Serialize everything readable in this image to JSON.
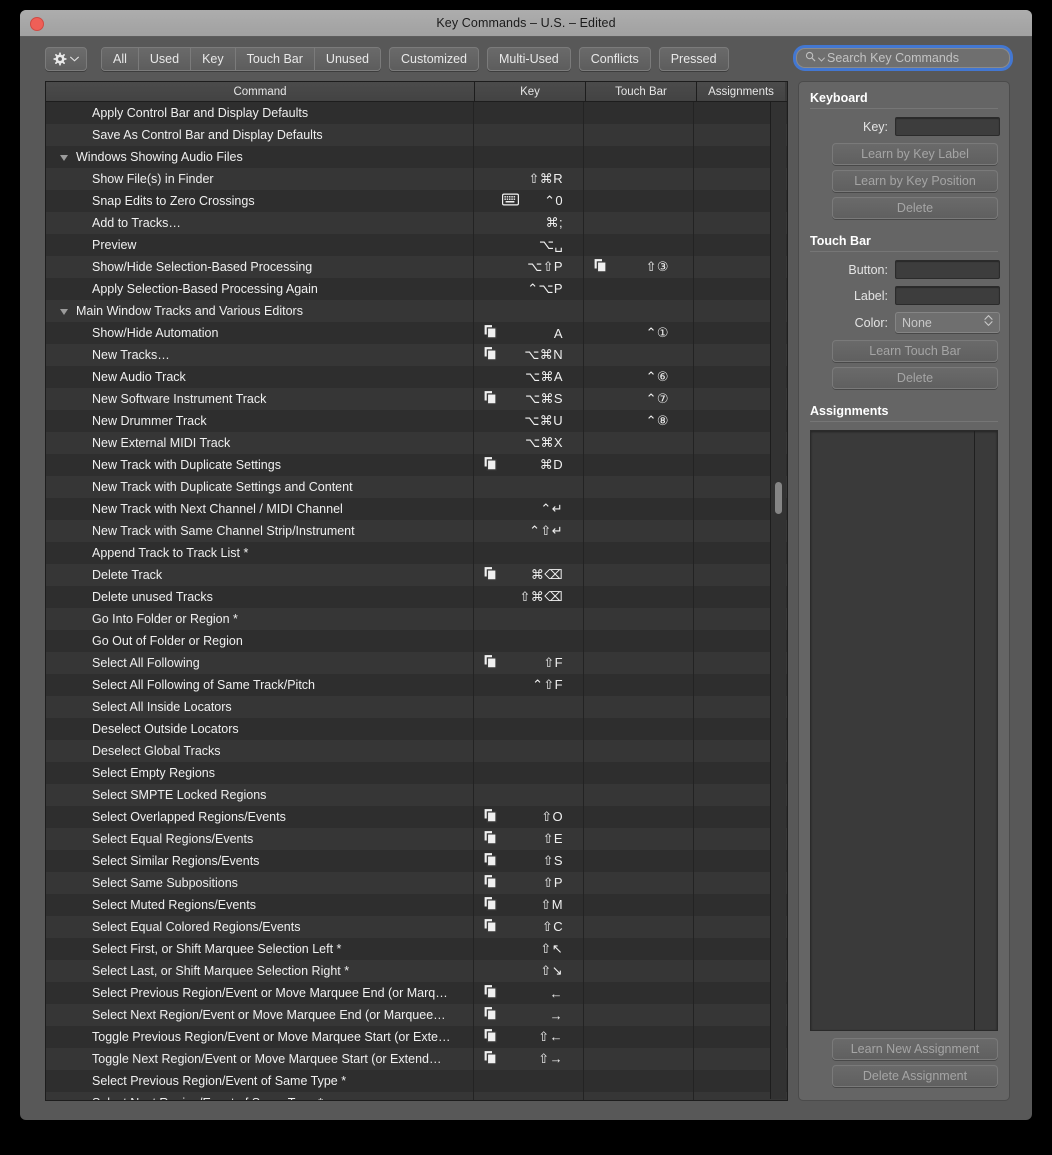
{
  "window": {
    "title": "Key Commands – U.S. – Edited",
    "close_icon": "close-dot"
  },
  "toolbar": {
    "action_menu_icon": "gear-icon",
    "action_menu_chevron": "chevron-down-icon",
    "segments": [
      "All",
      "Used",
      "Key",
      "Touch Bar",
      "Unused"
    ],
    "buttons": [
      "Customized",
      "Multi-Used",
      "Conflicts",
      "Pressed"
    ],
    "search": {
      "icon": "search-icon",
      "chevron": "chevron-down-icon",
      "placeholder": "Search Key Commands",
      "value": "",
      "focus_ring_color": "#407ce6"
    }
  },
  "table": {
    "columns": [
      "Command",
      "Key",
      "Touch Bar",
      "Assignments"
    ],
    "rows": [
      {
        "command": "Apply Control Bar and Display Defaults",
        "indent": 1,
        "key": "",
        "keyicon": "",
        "touchbar": "",
        "assignments": ""
      },
      {
        "command": "Save As Control Bar and Display Defaults",
        "indent": 1,
        "key": "",
        "keyicon": "",
        "touchbar": "",
        "assignments": ""
      },
      {
        "command": "Windows Showing Audio Files",
        "group": true,
        "key": "",
        "keyicon": "",
        "touchbar": "",
        "assignments": ""
      },
      {
        "command": "Show File(s) in Finder",
        "indent": 1,
        "key": "⇧⌘R",
        "keyicon": "",
        "touchbar": "",
        "assignments": ""
      },
      {
        "command": "Snap Edits to Zero Crossings",
        "indent": 1,
        "key": "⌃0",
        "keyicon": "keyboard-icon",
        "touchbar": "",
        "assignments": ""
      },
      {
        "command": "Add to Tracks…",
        "indent": 1,
        "key": "⌘;",
        "keyicon": "",
        "touchbar": "",
        "assignments": ""
      },
      {
        "command": "Preview",
        "indent": 1,
        "key": "⌥␣",
        "keyicon": "",
        "touchbar": "",
        "assignments": ""
      },
      {
        "command": "Show/Hide Selection-Based Processing",
        "indent": 1,
        "key": "⌥⇧P",
        "keyicon": "",
        "tbicon": "duplicate-icon",
        "touchbar": "⇧③",
        "assignments": ""
      },
      {
        "command": "Apply Selection-Based Processing Again",
        "indent": 1,
        "key": "⌃⌥P",
        "keyicon": "",
        "touchbar": "",
        "assignments": ""
      },
      {
        "command": "Main Window Tracks and Various Editors",
        "group": true,
        "key": "",
        "keyicon": "",
        "touchbar": "",
        "assignments": ""
      },
      {
        "command": "Show/Hide Automation",
        "indent": 1,
        "key": "A",
        "keyicon": "duplicate-icon",
        "touchbar": "⌃①",
        "assignments": ""
      },
      {
        "command": "New Tracks…",
        "indent": 1,
        "key": "⌥⌘N",
        "keyicon": "duplicate-icon",
        "touchbar": "",
        "assignments": ""
      },
      {
        "command": "New Audio Track",
        "indent": 1,
        "key": "⌥⌘A",
        "keyicon": "",
        "touchbar": "⌃⑥",
        "assignments": ""
      },
      {
        "command": "New Software Instrument Track",
        "indent": 1,
        "key": "⌥⌘S",
        "keyicon": "duplicate-icon",
        "touchbar": "⌃⑦",
        "assignments": ""
      },
      {
        "command": "New Drummer Track",
        "indent": 1,
        "key": "⌥⌘U",
        "keyicon": "",
        "touchbar": "⌃⑧",
        "assignments": ""
      },
      {
        "command": "New External MIDI Track",
        "indent": 1,
        "key": "⌥⌘X",
        "keyicon": "",
        "touchbar": "",
        "assignments": ""
      },
      {
        "command": "New Track with Duplicate Settings",
        "indent": 1,
        "key": "⌘D",
        "keyicon": "duplicate-icon",
        "touchbar": "",
        "assignments": ""
      },
      {
        "command": "New Track with Duplicate Settings and Content",
        "indent": 1,
        "key": "",
        "keyicon": "",
        "touchbar": "",
        "assignments": ""
      },
      {
        "command": "New Track with Next Channel / MIDI Channel",
        "indent": 1,
        "key": "⌃↵",
        "keyicon": "",
        "touchbar": "",
        "assignments": ""
      },
      {
        "command": "New Track with Same Channel Strip/Instrument",
        "indent": 1,
        "key": "⌃⇧↵",
        "keyicon": "",
        "touchbar": "",
        "assignments": ""
      },
      {
        "command": "Append Track to Track List *",
        "indent": 1,
        "key": "",
        "keyicon": "",
        "touchbar": "",
        "assignments": ""
      },
      {
        "command": "Delete Track",
        "indent": 1,
        "key": "⌘⌫",
        "keyicon": "duplicate-icon",
        "touchbar": "",
        "assignments": ""
      },
      {
        "command": "Delete unused Tracks",
        "indent": 1,
        "key": "⇧⌘⌫",
        "keyicon": "",
        "touchbar": "",
        "assignments": ""
      },
      {
        "command": "Go Into Folder or Region *",
        "indent": 1,
        "key": "",
        "keyicon": "",
        "touchbar": "",
        "assignments": ""
      },
      {
        "command": "Go Out of Folder or Region",
        "indent": 1,
        "key": "",
        "keyicon": "",
        "touchbar": "",
        "assignments": ""
      },
      {
        "command": "Select All Following",
        "indent": 1,
        "key": "⇧F",
        "keyicon": "duplicate-icon",
        "touchbar": "",
        "assignments": ""
      },
      {
        "command": "Select All Following of Same Track/Pitch",
        "indent": 1,
        "key": "⌃⇧F",
        "keyicon": "",
        "touchbar": "",
        "assignments": ""
      },
      {
        "command": "Select All Inside Locators",
        "indent": 1,
        "key": "",
        "keyicon": "",
        "touchbar": "",
        "assignments": ""
      },
      {
        "command": "Deselect Outside Locators",
        "indent": 1,
        "key": "",
        "keyicon": "",
        "touchbar": "",
        "assignments": ""
      },
      {
        "command": "Deselect Global Tracks",
        "indent": 1,
        "key": "",
        "keyicon": "",
        "touchbar": "",
        "assignments": ""
      },
      {
        "command": "Select Empty Regions",
        "indent": 1,
        "key": "",
        "keyicon": "",
        "touchbar": "",
        "assignments": ""
      },
      {
        "command": "Select SMPTE Locked Regions",
        "indent": 1,
        "key": "",
        "keyicon": "",
        "touchbar": "",
        "assignments": ""
      },
      {
        "command": "Select Overlapped Regions/Events",
        "indent": 1,
        "key": "⇧O",
        "keyicon": "duplicate-icon",
        "touchbar": "",
        "assignments": ""
      },
      {
        "command": "Select Equal Regions/Events",
        "indent": 1,
        "key": "⇧E",
        "keyicon": "duplicate-icon",
        "touchbar": "",
        "assignments": ""
      },
      {
        "command": "Select Similar Regions/Events",
        "indent": 1,
        "key": "⇧S",
        "keyicon": "duplicate-icon",
        "touchbar": "",
        "assignments": ""
      },
      {
        "command": "Select Same Subpositions",
        "indent": 1,
        "key": "⇧P",
        "keyicon": "duplicate-icon",
        "touchbar": "",
        "assignments": ""
      },
      {
        "command": "Select Muted Regions/Events",
        "indent": 1,
        "key": "⇧M",
        "keyicon": "duplicate-icon",
        "touchbar": "",
        "assignments": ""
      },
      {
        "command": "Select Equal Colored Regions/Events",
        "indent": 1,
        "key": "⇧C",
        "keyicon": "duplicate-icon",
        "touchbar": "",
        "assignments": ""
      },
      {
        "command": "Select First, or Shift Marquee Selection Left *",
        "indent": 1,
        "key": "⇧↖",
        "keyicon": "",
        "touchbar": "",
        "assignments": ""
      },
      {
        "command": "Select Last, or Shift Marquee Selection Right *",
        "indent": 1,
        "key": "⇧↘",
        "keyicon": "",
        "touchbar": "",
        "assignments": ""
      },
      {
        "command": "Select Previous Region/Event or Move Marquee End (or Marq…",
        "indent": 1,
        "key": "←",
        "keyicon": "duplicate-icon",
        "touchbar": "",
        "assignments": ""
      },
      {
        "command": "Select Next Region/Event or Move Marquee End (or Marquee…",
        "indent": 1,
        "key": "→",
        "keyicon": "duplicate-icon",
        "touchbar": "",
        "assignments": ""
      },
      {
        "command": "Toggle Previous Region/Event or Move Marquee Start (or Exte…",
        "indent": 1,
        "key": "⇧←",
        "keyicon": "duplicate-icon",
        "touchbar": "",
        "assignments": ""
      },
      {
        "command": "Toggle Next Region/Event or Move Marquee Start (or Extend…",
        "indent": 1,
        "key": "⇧→",
        "keyicon": "duplicate-icon",
        "touchbar": "",
        "assignments": ""
      },
      {
        "command": "Select Previous Region/Event of Same Type *",
        "indent": 1,
        "key": "",
        "keyicon": "",
        "touchbar": "",
        "assignments": ""
      },
      {
        "command": "Select Next Region/Event of Same Type *",
        "indent": 1,
        "key": "",
        "keyicon": "",
        "touchbar": "",
        "assignments": "",
        "clipped": true
      }
    ]
  },
  "sidebar": {
    "keyboard": {
      "title": "Keyboard",
      "key_label": "Key:",
      "key_value": "",
      "learn_by_key_label": "Learn by Key Label",
      "learn_by_key_position": "Learn by Key Position",
      "delete": "Delete"
    },
    "touchbar": {
      "title": "Touch Bar",
      "button_label": "Button:",
      "button_value": "",
      "label_label": "Label:",
      "label_value": "",
      "color_label": "Color:",
      "color_value": "None",
      "color_chevron": "chevron-up-down-icon",
      "learn_touch_bar": "Learn Touch Bar",
      "delete": "Delete"
    },
    "assignments": {
      "title": "Assignments",
      "items": [],
      "learn_new_assignment": "Learn New Assignment",
      "delete_assignment": "Delete Assignment"
    }
  }
}
